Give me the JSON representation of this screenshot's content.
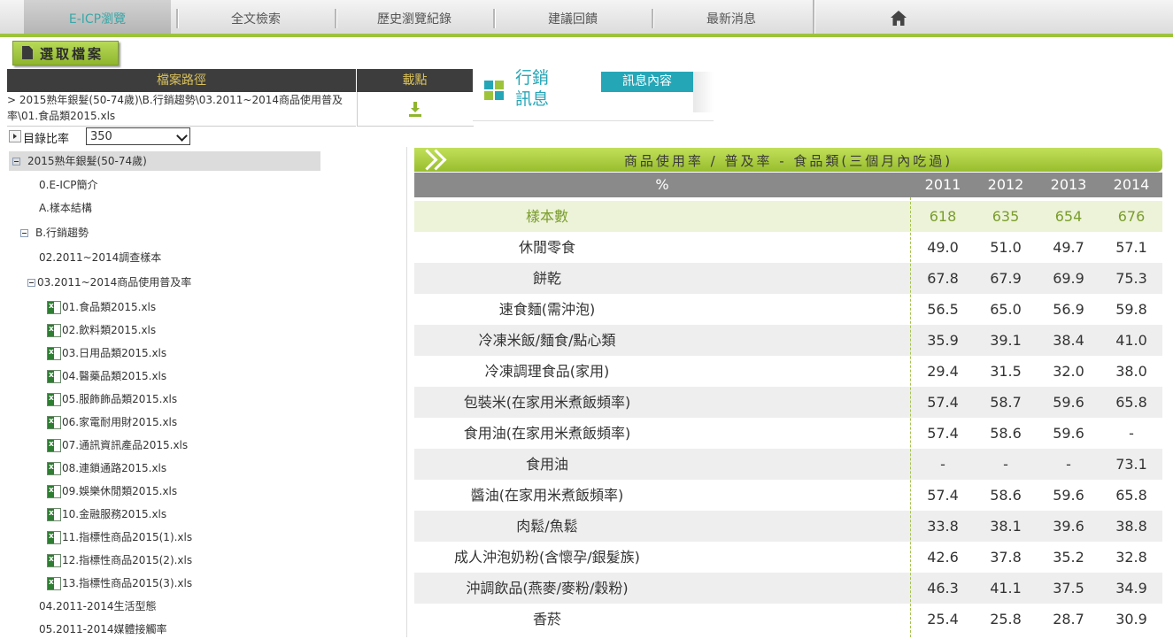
{
  "nav": {
    "items": [
      "E-ICP瀏覽",
      "全文檢索",
      "歷史瀏覽紀錄",
      "建議回饋",
      "最新消息"
    ]
  },
  "select_button": "選取檔案",
  "path_table": {
    "header_path": "檔案路徑",
    "header_download": "載點",
    "path_line1": "> 2015熟年銀髮(50-74歲)\\B.行銷趨勢\\03.2011~2014商品使用普及",
    "path_line2": "率\\01.食品類2015.xls"
  },
  "marketing": {
    "title_line1": "行銷",
    "title_line2": "訊息",
    "button": "訊息內容"
  },
  "ratio": {
    "label": "目錄比率",
    "value": "350"
  },
  "tree": [
    {
      "label": "2015熟年銀髮(50-74歲)"
    },
    {
      "label": "0.E-ICP簡介"
    },
    {
      "label": "A.樣本結構"
    },
    {
      "label": "B.行銷趨勢"
    },
    {
      "label": "02.2011~2014調查樣本"
    },
    {
      "label": "03.2011~2014商品使用普及率"
    },
    {
      "label": "01.食品類2015.xls"
    },
    {
      "label": "02.飲料類2015.xls"
    },
    {
      "label": "03.日用品類2015.xls"
    },
    {
      "label": "04.醫藥品類2015.xls"
    },
    {
      "label": "05.服飾飾品類2015.xls"
    },
    {
      "label": "06.家電耐用財2015.xls"
    },
    {
      "label": "07.通訊資訊產品2015.xls"
    },
    {
      "label": "08.連鎖通路2015.xls"
    },
    {
      "label": "09.娛樂休閒類2015.xls"
    },
    {
      "label": "10.金融服務2015.xls"
    },
    {
      "label": "11.指標性商品2015(1).xls"
    },
    {
      "label": "12.指標性商品2015(2).xls"
    },
    {
      "label": "13.指標性商品2015(3).xls"
    },
    {
      "label": "04.2011-2014生活型態"
    },
    {
      "label": "05.2011-2014媒體接觸率"
    }
  ],
  "table": {
    "title": "商品使用率 / 普及率 - 食品類(三個月內吃過)",
    "unit_header": "%",
    "years": [
      "2011",
      "2012",
      "2013",
      "2014"
    ],
    "rows": [
      {
        "label": "樣本數",
        "values": [
          "618",
          "635",
          "654",
          "676"
        ]
      },
      {
        "label": "休閒零食",
        "values": [
          "49.0",
          "51.0",
          "49.7",
          "57.1"
        ]
      },
      {
        "label": "餅乾",
        "values": [
          "67.8",
          "67.9",
          "69.9",
          "75.3"
        ]
      },
      {
        "label": "速食麵(需沖泡)",
        "values": [
          "56.5",
          "65.0",
          "56.9",
          "59.8"
        ]
      },
      {
        "label": "冷凍米飯/麵食/點心類",
        "values": [
          "35.9",
          "39.1",
          "38.4",
          "41.0"
        ]
      },
      {
        "label": "冷凍調理食品(家用)",
        "values": [
          "29.4",
          "31.5",
          "32.0",
          "38.0"
        ]
      },
      {
        "label": "包裝米(在家用米煮飯頻率)",
        "values": [
          "57.4",
          "58.7",
          "59.6",
          "65.8"
        ]
      },
      {
        "label": "食用油(在家用米煮飯頻率)",
        "values": [
          "57.4",
          "58.6",
          "59.6",
          "-"
        ]
      },
      {
        "label": "食用油",
        "values": [
          "-",
          "-",
          "-",
          "73.1"
        ]
      },
      {
        "label": "醬油(在家用米煮飯頻率)",
        "values": [
          "57.4",
          "58.6",
          "59.6",
          "65.8"
        ]
      },
      {
        "label": "肉鬆/魚鬆",
        "values": [
          "33.8",
          "38.1",
          "39.6",
          "38.8"
        ]
      },
      {
        "label": "成人沖泡奶粉(含懷孕/銀髮族)",
        "values": [
          "42.6",
          "37.8",
          "35.2",
          "32.8"
        ]
      },
      {
        "label": "沖調飲品(燕麥/麥粉/穀粉)",
        "values": [
          "46.3",
          "41.1",
          "37.5",
          "34.9"
        ]
      },
      {
        "label": "香菸",
        "values": [
          "25.4",
          "25.8",
          "28.7",
          "30.9"
        ]
      }
    ]
  },
  "colors": {
    "accent_green": "#9dc33b",
    "teal": "#25a6b7",
    "header_gold": "#d9c15b"
  }
}
